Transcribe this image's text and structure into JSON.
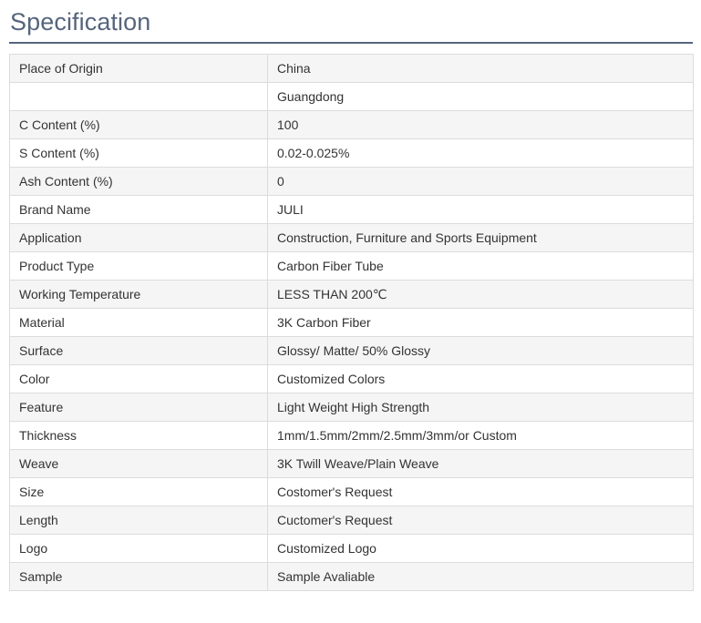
{
  "section": {
    "title": "Specification"
  },
  "rows": [
    {
      "label": "Place of Origin",
      "value": "China"
    },
    {
      "label": "",
      "value": "Guangdong"
    },
    {
      "label": "C Content (%)",
      "value": "100"
    },
    {
      "label": "S Content (%)",
      "value": "0.02-0.025%"
    },
    {
      "label": "Ash Content (%)",
      "value": "0"
    },
    {
      "label": "Brand Name",
      "value": "JULI"
    },
    {
      "label": "Application",
      "value": "Construction, Furniture and Sports Equipment"
    },
    {
      "label": "Product Type",
      "value": "Carbon Fiber Tube"
    },
    {
      "label": "Working Temperature",
      "value": "LESS THAN 200℃"
    },
    {
      "label": "Material",
      "value": "3K Carbon Fiber"
    },
    {
      "label": "Surface",
      "value": "Glossy/ Matte/ 50% Glossy"
    },
    {
      "label": "Color",
      "value": "Customized Colors"
    },
    {
      "label": "Feature",
      "value": "Light Weight High Strength"
    },
    {
      "label": "Thickness",
      "value": "1mm/1.5mm/2mm/2.5mm/3mm/or Custom"
    },
    {
      "label": "Weave",
      "value": "3K Twill Weave/Plain Weave"
    },
    {
      "label": "Size",
      "value": "Costomer's Request"
    },
    {
      "label": "Length",
      "value": "Cuctomer's Request"
    },
    {
      "label": "Logo",
      "value": "Customized Logo"
    },
    {
      "label": "Sample",
      "value": "Sample Avaliable"
    }
  ]
}
